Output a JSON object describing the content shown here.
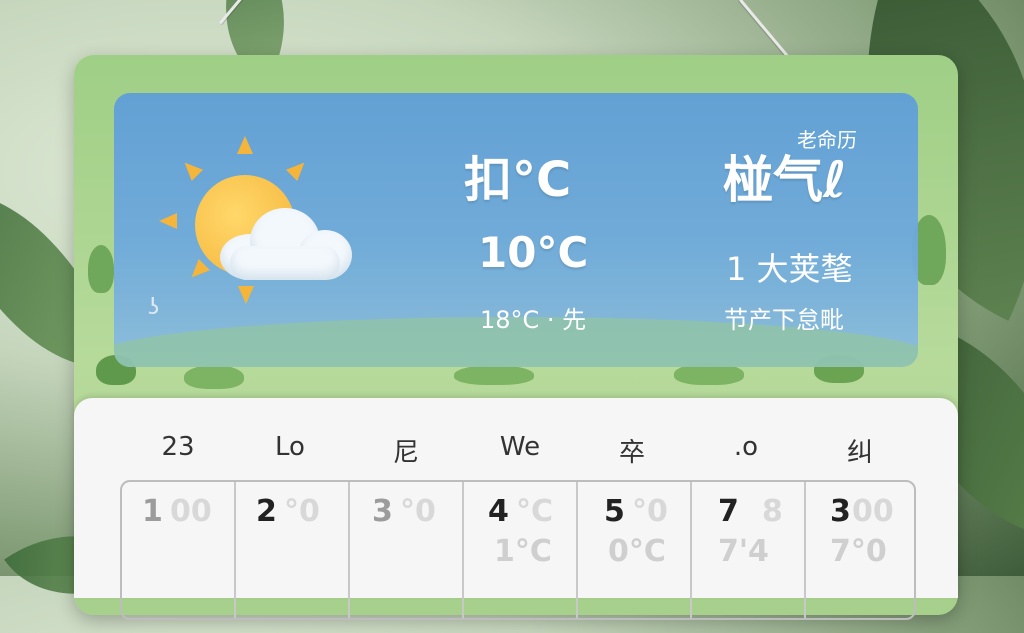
{
  "weather": {
    "temp_main": "扣°C",
    "temp_secondary": "10°C",
    "temp_detail": "18°C · 先",
    "calendar_label": "老命历",
    "title": "椪气ℓ",
    "wind": "1 大荚㲠",
    "note": "节产下怠毗"
  },
  "calendar": {
    "weekdays": [
      "23",
      "Lo",
      "尼",
      "We",
      "卒",
      ".o",
      "纠"
    ],
    "days": [
      {
        "num": "1",
        "ghost": "00",
        "dim": true
      },
      {
        "num": "2",
        "ghost": "°0",
        "dim": false
      },
      {
        "num": "3",
        "ghost": "°0",
        "dim": true
      },
      {
        "num": "4",
        "ghost": "°C",
        "sub": "1°C",
        "dim": false
      },
      {
        "num": "5",
        "ghost": "°0",
        "sub": "0°C",
        "dim": false
      },
      {
        "num": "7",
        "ghost": "8",
        "sub": "7'4",
        "dim": false
      },
      {
        "num": "3",
        "ghost": "00",
        "sub": "7°0",
        "dim": false
      }
    ]
  },
  "colors": {
    "panel": "#6ea9dc",
    "card": "#a6d08c",
    "sun": "#f5b43a"
  }
}
